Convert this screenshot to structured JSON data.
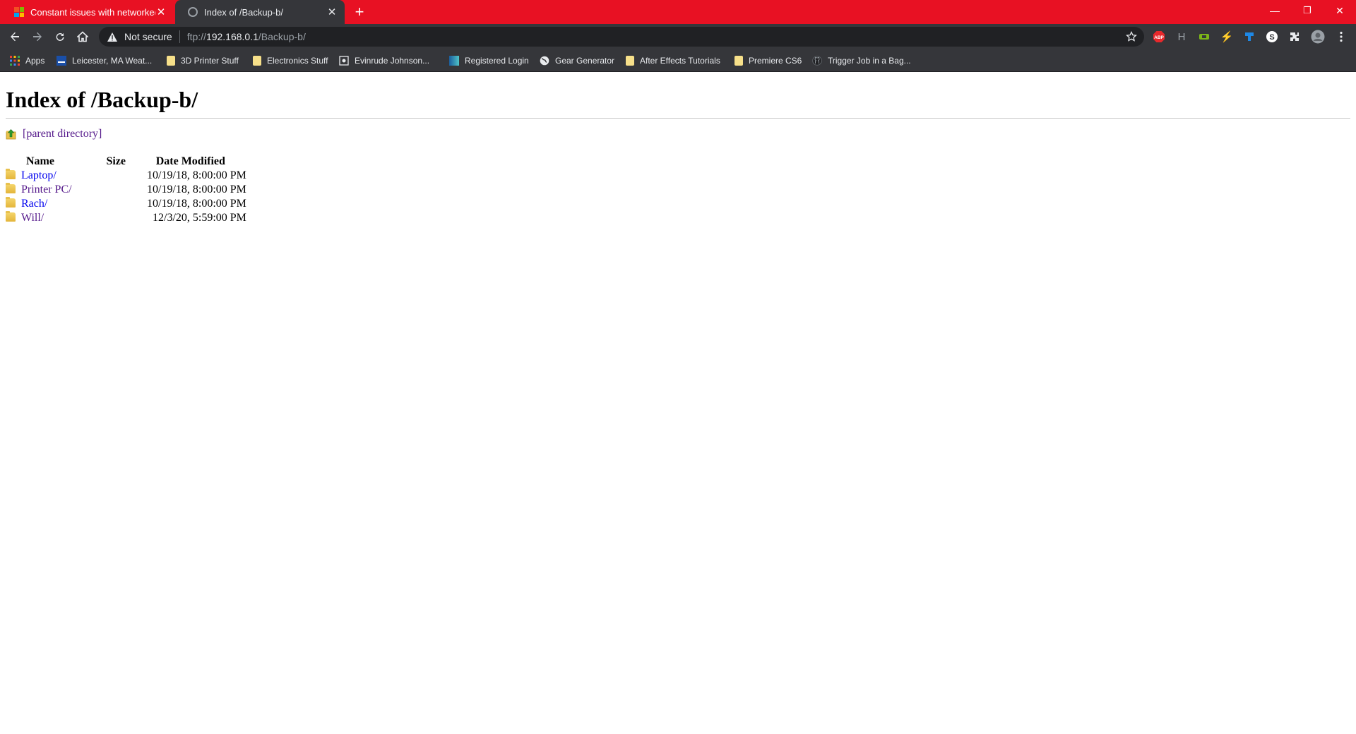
{
  "tabs": [
    {
      "title": "Constant issues with networked c",
      "state": "inactive",
      "favicon": "microsoft-logo"
    },
    {
      "title": "Index of /Backup-b/",
      "state": "active",
      "favicon": "globe-icon"
    }
  ],
  "window_controls": {
    "minimize": "—",
    "restore": "❐",
    "close": "✕"
  },
  "toolbar": {
    "security_label": "Not secure",
    "url": {
      "scheme": "ftp://",
      "host": "192.168.0.1",
      "path": "/Backup-b/"
    }
  },
  "extensions": [
    {
      "name": "adblock-plus-icon",
      "label": "ABP",
      "color": "#e8282b"
    },
    {
      "name": "honey-h-icon",
      "label": "H",
      "color": "#9aa0a6"
    },
    {
      "name": "green-extension-icon",
      "label": "",
      "color": "#7cb518"
    },
    {
      "name": "lightning-extension-icon",
      "label": "⚡",
      "color": "#f2c200"
    },
    {
      "name": "blue-extension-icon",
      "label": "",
      "color": "#1e88e5"
    },
    {
      "name": "s-extension-icon",
      "label": "S",
      "color": "#ffffff"
    },
    {
      "name": "puzzle-extensions-icon",
      "label": "",
      "color": "#e8eaed"
    },
    {
      "name": "profile-avatar",
      "label": "",
      "color": "#9aa0a6"
    }
  ],
  "bookmarks": [
    {
      "label": "Apps",
      "icon": "apps-grid-icon"
    },
    {
      "label": "Leicester, MA Weat...",
      "icon": "weather-site-icon"
    },
    {
      "label": "3D Printer Stuff",
      "icon": "folder-icon"
    },
    {
      "label": "Electronics Stuff",
      "icon": "folder-icon"
    },
    {
      "label": "Evinrude Johnson...",
      "icon": "site-icon"
    },
    {
      "label": "Registered Login",
      "icon": "site-icon"
    },
    {
      "label": "Gear Generator",
      "icon": "globe-icon"
    },
    {
      "label": "After Effects Tutorials",
      "icon": "folder-icon"
    },
    {
      "label": "Premiere CS6",
      "icon": "folder-icon"
    },
    {
      "label": "Trigger Job in a Bag...",
      "icon": "github-icon"
    }
  ],
  "page": {
    "heading": "Index of /Backup-b/",
    "parent_link": "[parent directory]",
    "columns": {
      "name": "Name",
      "size": "Size",
      "date": "Date Modified"
    },
    "entries": [
      {
        "name": "Laptop/",
        "size": "",
        "date": "10/19/18, 8:00:00 PM"
      },
      {
        "name": "Printer PC/",
        "size": "",
        "date": "10/19/18, 8:00:00 PM"
      },
      {
        "name": "Rach/",
        "size": "",
        "date": "10/19/18, 8:00:00 PM"
      },
      {
        "name": "Will/",
        "size": "",
        "date": "12/3/20, 5:59:00 PM"
      }
    ]
  },
  "colors": {
    "tabstrip": "#e81123",
    "toolbar": "#35363a",
    "omnibox": "#202124",
    "link": "#0000ee",
    "visited_link": "#551a8b"
  }
}
